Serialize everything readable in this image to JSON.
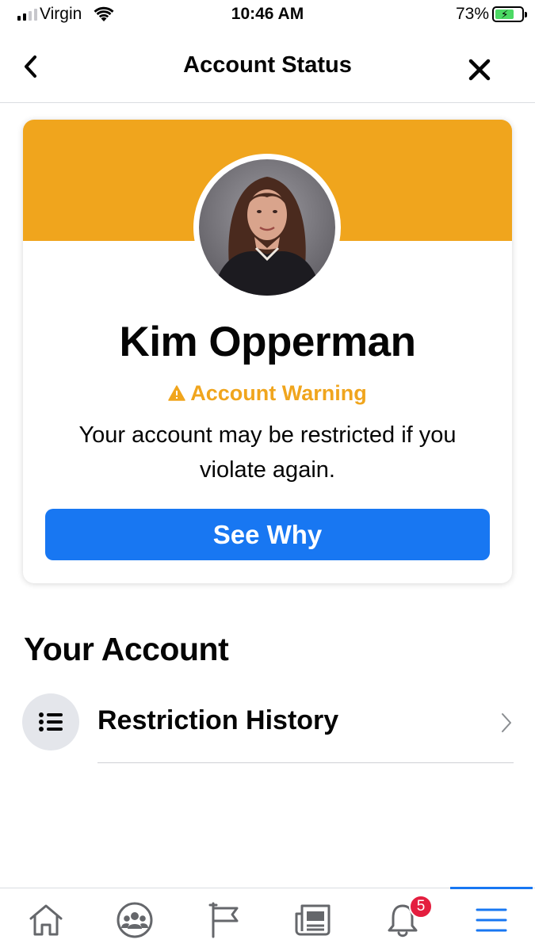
{
  "status_bar": {
    "carrier": "Virgin",
    "time": "10:46 AM",
    "battery_percent": "73%",
    "battery_level": 0.73,
    "signal_bars": 2
  },
  "header": {
    "title": "Account Status",
    "back_icon": "chevron-left-icon",
    "close_icon": "close-icon"
  },
  "card": {
    "banner_color": "#f0a51d",
    "profile_name": "Kim Opperman",
    "warning_label": "Account Warning",
    "warning_color": "#f0a51d",
    "message": "Your account may be restricted if you violate again.",
    "button_label": "See Why",
    "button_color": "#1877f2"
  },
  "your_account": {
    "title": "Your Account",
    "items": [
      {
        "label": "Restriction History",
        "icon": "list-icon"
      }
    ]
  },
  "bottom_nav": {
    "items": [
      {
        "name": "home",
        "icon": "home-icon"
      },
      {
        "name": "groups",
        "icon": "groups-icon"
      },
      {
        "name": "pages",
        "icon": "flag-icon"
      },
      {
        "name": "news",
        "icon": "news-icon"
      },
      {
        "name": "notifications",
        "icon": "bell-icon",
        "badge": "5"
      },
      {
        "name": "menu",
        "icon": "menu-icon",
        "active": true
      }
    ],
    "active_color": "#1877f2"
  }
}
